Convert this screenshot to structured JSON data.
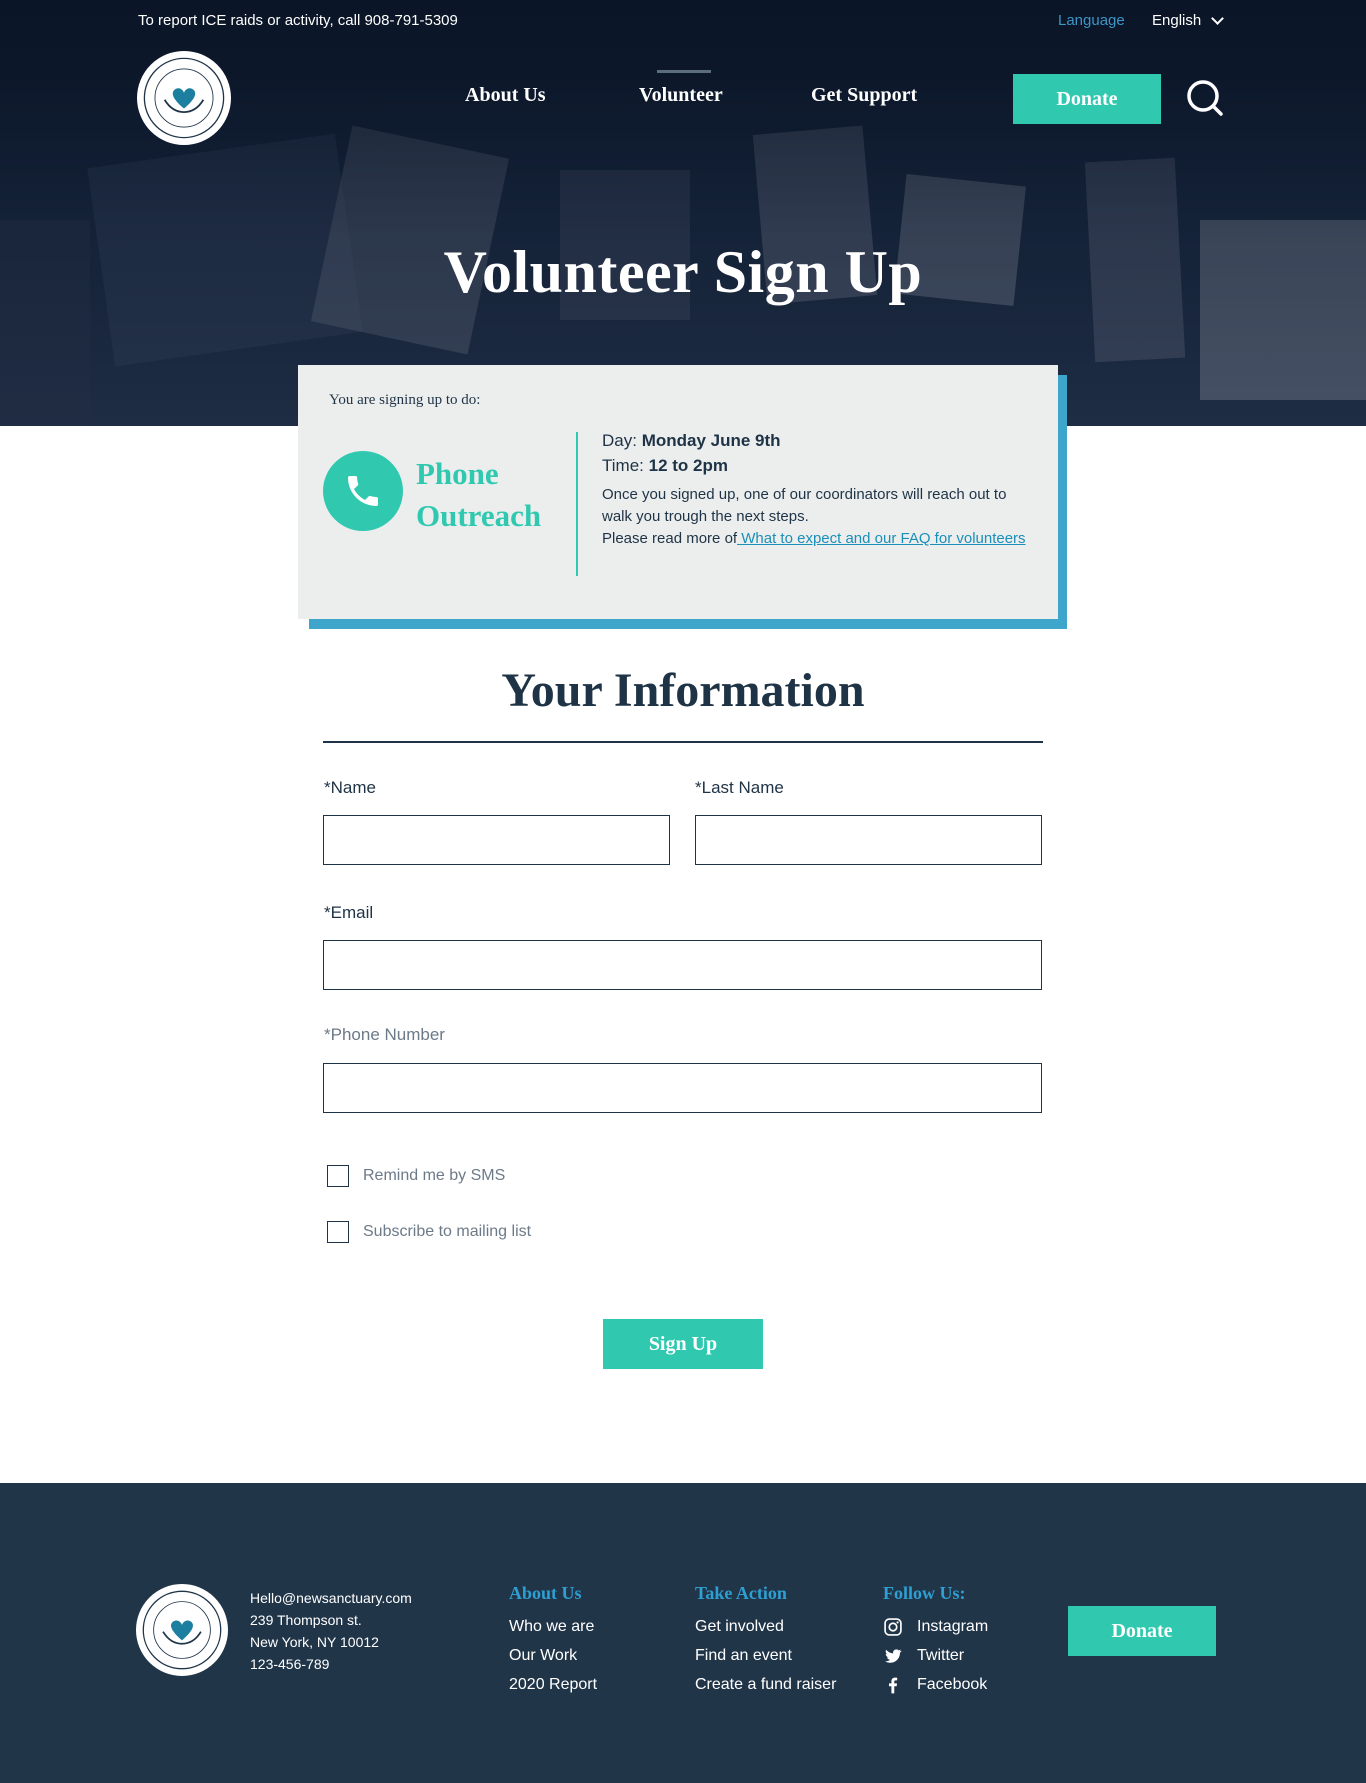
{
  "header": {
    "report_notice": "To report ICE raids or activity, call 908-791-5309",
    "language_label": "Language",
    "language_selected": "English",
    "nav": [
      {
        "label": "About Us"
      },
      {
        "label": "Volunteer"
      },
      {
        "label": "Get Support"
      }
    ],
    "donate_label": "Donate",
    "hero_title": "Volunteer Sign Up"
  },
  "signup_card": {
    "intro": "You are signing up to do:",
    "activity": "Phone Outreach",
    "day_label": "Day:",
    "day_value": "Monday June 9th",
    "time_label": "Time:",
    "time_value": "12 to 2pm",
    "description": "Once you signed up, one of our coordinators will reach out to walk you trough the next steps.",
    "read_more_prefix": "Please read more of",
    "read_more_link": " What to expect and our FAQ for volunteers"
  },
  "form": {
    "title": "Your Information",
    "name_label": "*Name",
    "last_name_label": "*Last Name",
    "email_label": "*Email",
    "phone_label": "*Phone Number",
    "name_value": "",
    "last_name_value": "",
    "email_value": "",
    "phone_value": "",
    "checkboxes": [
      {
        "label": "Remind me by SMS",
        "checked": false
      },
      {
        "label": "Subscribe to mailing list",
        "checked": false
      }
    ],
    "submit_label": "Sign Up"
  },
  "footer": {
    "email": "Hello@newsanctuary.com",
    "address_line1": "239 Thompson st.",
    "address_line2": "New York, NY 10012",
    "phone": "123-456-789",
    "columns": [
      {
        "heading": "About Us",
        "links": [
          "Who we are",
          "Our Work",
          "2020 Report"
        ]
      },
      {
        "heading": "Take Action",
        "links": [
          "Get involved",
          "Find an event",
          "Create a fund raiser"
        ]
      }
    ],
    "follow_heading": "Follow Us:",
    "social": [
      {
        "label": "Instagram",
        "icon": "instagram-icon"
      },
      {
        "label": "Twitter",
        "icon": "twitter-icon"
      },
      {
        "label": "Facebook",
        "icon": "facebook-icon"
      }
    ],
    "donate_label": "Donate"
  },
  "colors": {
    "accent_teal": "#30c9b0",
    "accent_blue": "#3fa6cb",
    "navy": "#213549",
    "link_blue": "#1a8fb9"
  }
}
